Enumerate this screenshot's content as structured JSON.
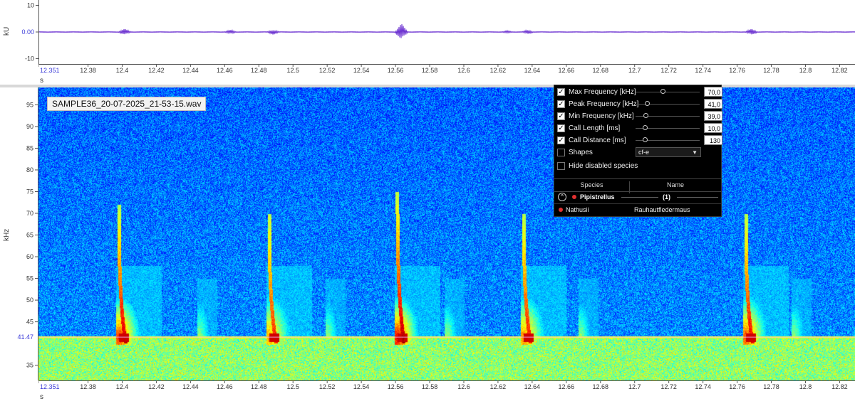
{
  "waveform": {
    "unit": "kU",
    "time_unit": "s",
    "y_ticks": [
      "10",
      "0.00",
      "-10"
    ],
    "y_tick_values": [
      10,
      0,
      -10
    ],
    "x_ticks": [
      "12.351",
      "12.38",
      "12.4",
      "12.42",
      "12.44",
      "12.46",
      "12.48",
      "12.5",
      "12.52",
      "12.54",
      "12.56",
      "12.58",
      "12.6",
      "12.62",
      "12.64",
      "12.66",
      "12.68",
      "12.7",
      "12.72",
      "12.74",
      "12.76",
      "12.78",
      "12.8",
      "12.82"
    ],
    "x_tick_values": [
      12.351,
      12.38,
      12.4,
      12.42,
      12.44,
      12.46,
      12.48,
      12.5,
      12.52,
      12.54,
      12.56,
      12.58,
      12.6,
      12.62,
      12.64,
      12.66,
      12.68,
      12.7,
      12.72,
      12.74,
      12.76,
      12.78,
      12.8,
      12.82
    ],
    "x_range": [
      12.351,
      12.829
    ],
    "y_range": [
      -12,
      12
    ],
    "line_color": "#6a2fd0",
    "bursts": [
      {
        "t": 12.401,
        "amp": 1.2
      },
      {
        "t": 12.463,
        "amp": 0.8
      },
      {
        "t": 12.488,
        "amp": 1.0
      },
      {
        "t": 12.563,
        "amp": 3.2
      },
      {
        "t": 12.625,
        "amp": 0.5
      },
      {
        "t": 12.637,
        "amp": 0.8
      },
      {
        "t": 12.768,
        "amp": 1.2
      }
    ]
  },
  "spectrogram": {
    "file_name": "SAMPLE36_20-07-2025_21-53-15.wav",
    "y_unit": "kHz",
    "x_unit": "s",
    "y_ticks": [
      "95",
      "90",
      "85",
      "80",
      "75",
      "70",
      "65",
      "60",
      "55",
      "50",
      "45",
      "35"
    ],
    "y_tick_values": [
      95,
      90,
      85,
      80,
      75,
      70,
      65,
      60,
      55,
      50,
      45,
      35
    ],
    "marker_label": "41.47",
    "marker_value": 41.47,
    "marker_color": "#3a3ad8",
    "y_range": [
      31.5,
      99
    ],
    "x_range": [
      12.351,
      12.829
    ],
    "x_ticks": [
      "12.351",
      "12.38",
      "12.4",
      "12.42",
      "12.44",
      "12.46",
      "12.48",
      "12.5",
      "12.52",
      "12.54",
      "12.56",
      "12.58",
      "12.6",
      "12.62",
      "12.64",
      "12.66",
      "12.68",
      "12.7",
      "12.72",
      "12.74",
      "12.76",
      "12.78",
      "12.8",
      "12.82"
    ],
    "x_tick_values": [
      12.351,
      12.38,
      12.4,
      12.42,
      12.44,
      12.46,
      12.48,
      12.5,
      12.52,
      12.54,
      12.56,
      12.58,
      12.6,
      12.62,
      12.64,
      12.66,
      12.68,
      12.7,
      12.72,
      12.74,
      12.76,
      12.78,
      12.8,
      12.82
    ],
    "calls": [
      {
        "t": 12.398,
        "top_khz": 72,
        "strength": 1.0
      },
      {
        "t": 12.486,
        "top_khz": 70,
        "strength": 0.8
      },
      {
        "t": 12.561,
        "top_khz": 75,
        "strength": 1.1
      },
      {
        "t": 12.635,
        "top_khz": 70,
        "strength": 0.85
      },
      {
        "t": 12.765,
        "top_khz": 70,
        "strength": 0.95
      }
    ],
    "echoes": [
      12.445,
      12.52,
      12.59,
      12.668,
      12.793
    ]
  },
  "filter_panel": {
    "rows": [
      {
        "label": "Max Frequency [kHz]",
        "checked": true,
        "value": "70,0",
        "knob": 0.42
      },
      {
        "label": "Peak Frequency [kHz]",
        "checked": true,
        "value": "41,0",
        "knob": 0.18
      },
      {
        "label": "Min Frequency [kHz]",
        "checked": true,
        "value": "39,0",
        "knob": 0.16
      },
      {
        "label": "Call Length [ms]",
        "checked": true,
        "value": "10,0",
        "knob": 0.14
      },
      {
        "label": "Call Distance [ms]",
        "checked": true,
        "value": "130",
        "knob": 0.14
      }
    ],
    "shapes_label": "Shapes",
    "shapes_checked": false,
    "shapes_value": "cf-e",
    "hide_disabled_label": "Hide disabled species",
    "hide_disabled_checked": false,
    "table_headers": [
      "Species",
      "Name"
    ],
    "group": {
      "name": "Pipistrellus",
      "count": "(1)",
      "expand_symbol": "^"
    },
    "species": [
      {
        "species": "Nathusii",
        "name": "Rauhautfledermaus"
      }
    ]
  }
}
